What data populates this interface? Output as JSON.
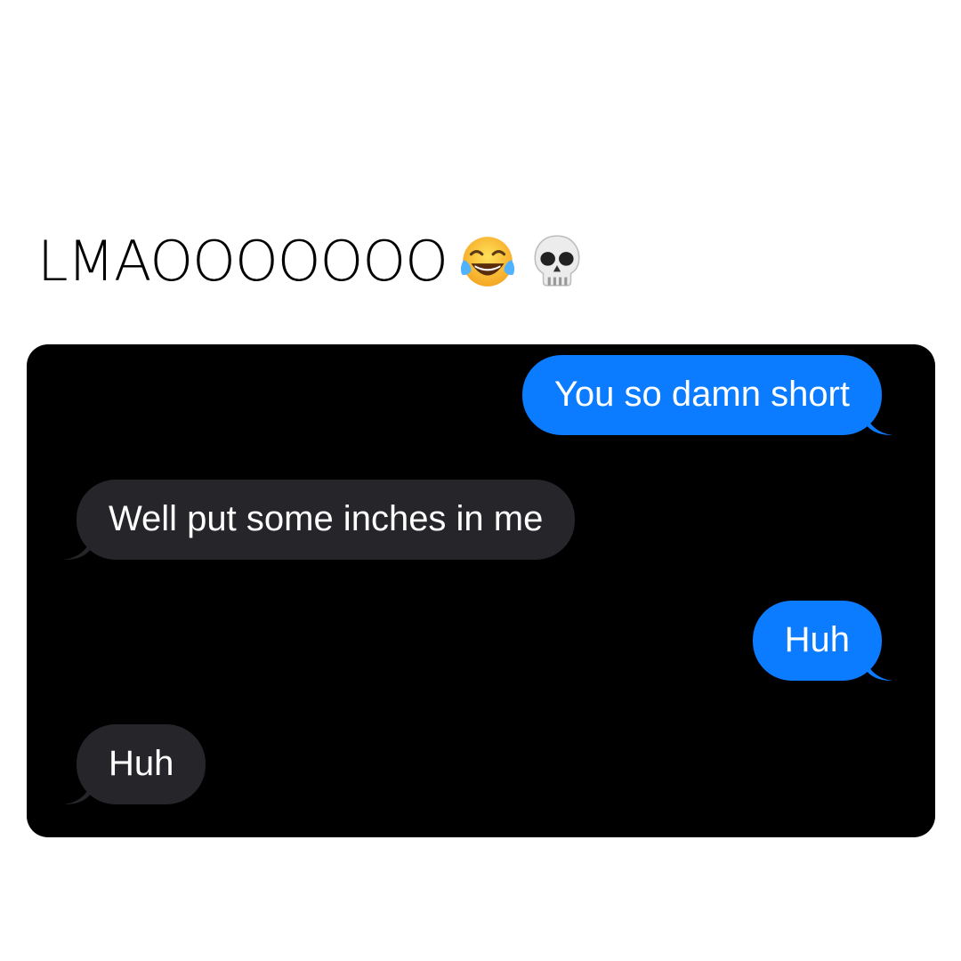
{
  "caption": {
    "text": "LMAOOOOOOO",
    "emojis": [
      "face-with-tears-of-joy-icon",
      "skull-icon"
    ]
  },
  "conversation": {
    "messages": [
      {
        "sender": "me",
        "text": "You so damn short"
      },
      {
        "sender": "them",
        "text": "Well put some inches in me"
      },
      {
        "sender": "me",
        "text": "Huh"
      },
      {
        "sender": "them",
        "text": "Huh"
      }
    ]
  },
  "colors": {
    "sent_bubble": "#0b7cff",
    "received_bubble": "#26252a",
    "chat_background": "#000000",
    "page_background": "#ffffff"
  }
}
